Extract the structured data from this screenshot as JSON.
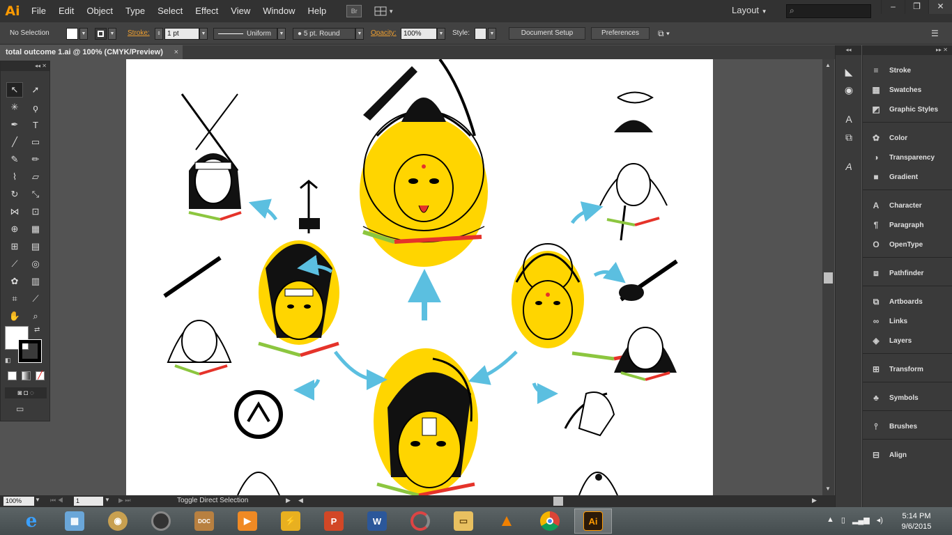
{
  "app": {
    "logo": "Ai",
    "menu": [
      "File",
      "Edit",
      "Object",
      "Type",
      "Select",
      "Effect",
      "View",
      "Window",
      "Help"
    ],
    "bridge": "Br",
    "workspace": "Layout",
    "search_placeholder": ""
  },
  "control": {
    "selection": "No Selection",
    "stroke_label": "Stroke:",
    "stroke_weight": "1 pt",
    "profile": "Uniform",
    "brush": "5 pt. Round",
    "opacity_label": "Opacity:",
    "opacity": "100%",
    "style_label": "Style:",
    "document_setup": "Document Setup",
    "preferences": "Preferences"
  },
  "document": {
    "tab_title": "total outcome 1.ai @ 100% (CMYK/Preview)"
  },
  "status": {
    "zoom": "100%",
    "artboard": "1",
    "tool_hint": "Toggle Direct Selection"
  },
  "panels": [
    {
      "label": "Stroke",
      "icon": "stroke-icon"
    },
    {
      "label": "Swatches",
      "icon": "swatches-icon"
    },
    {
      "label": "Graphic Styles",
      "icon": "graphic-styles-icon"
    },
    {
      "label": "Color",
      "icon": "color-icon"
    },
    {
      "label": "Transparency",
      "icon": "transparency-icon"
    },
    {
      "label": "Gradient",
      "icon": "gradient-icon"
    },
    {
      "label": "Character",
      "icon": "character-icon"
    },
    {
      "label": "Paragraph",
      "icon": "paragraph-icon"
    },
    {
      "label": "OpenType",
      "icon": "opentype-icon"
    },
    {
      "label": "Pathfinder",
      "icon": "pathfinder-icon"
    },
    {
      "label": "Artboards",
      "icon": "artboards-icon"
    },
    {
      "label": "Links",
      "icon": "links-icon"
    },
    {
      "label": "Layers",
      "icon": "layers-icon"
    },
    {
      "label": "Transform",
      "icon": "transform-icon"
    },
    {
      "label": "Symbols",
      "icon": "symbols-icon"
    },
    {
      "label": "Brushes",
      "icon": "brushes-icon"
    },
    {
      "label": "Align",
      "icon": "align-icon"
    }
  ],
  "taskbar": {
    "time": "5:14 PM",
    "date": "9/6/2015",
    "apps": [
      "internet-explorer",
      "control-panel",
      "media-app",
      "speaker-app",
      "document-app",
      "media-player",
      "winamp",
      "powerpoint",
      "word",
      "loading-app",
      "file-explorer",
      "vlc",
      "chrome",
      "illustrator"
    ]
  },
  "colors": {
    "accent_orange": "#ff9a00",
    "artwork_yellow": "#ffd500",
    "arrow_blue": "#5bbfe0",
    "bar_green": "#8cc63f",
    "bar_red": "#e5332a"
  }
}
